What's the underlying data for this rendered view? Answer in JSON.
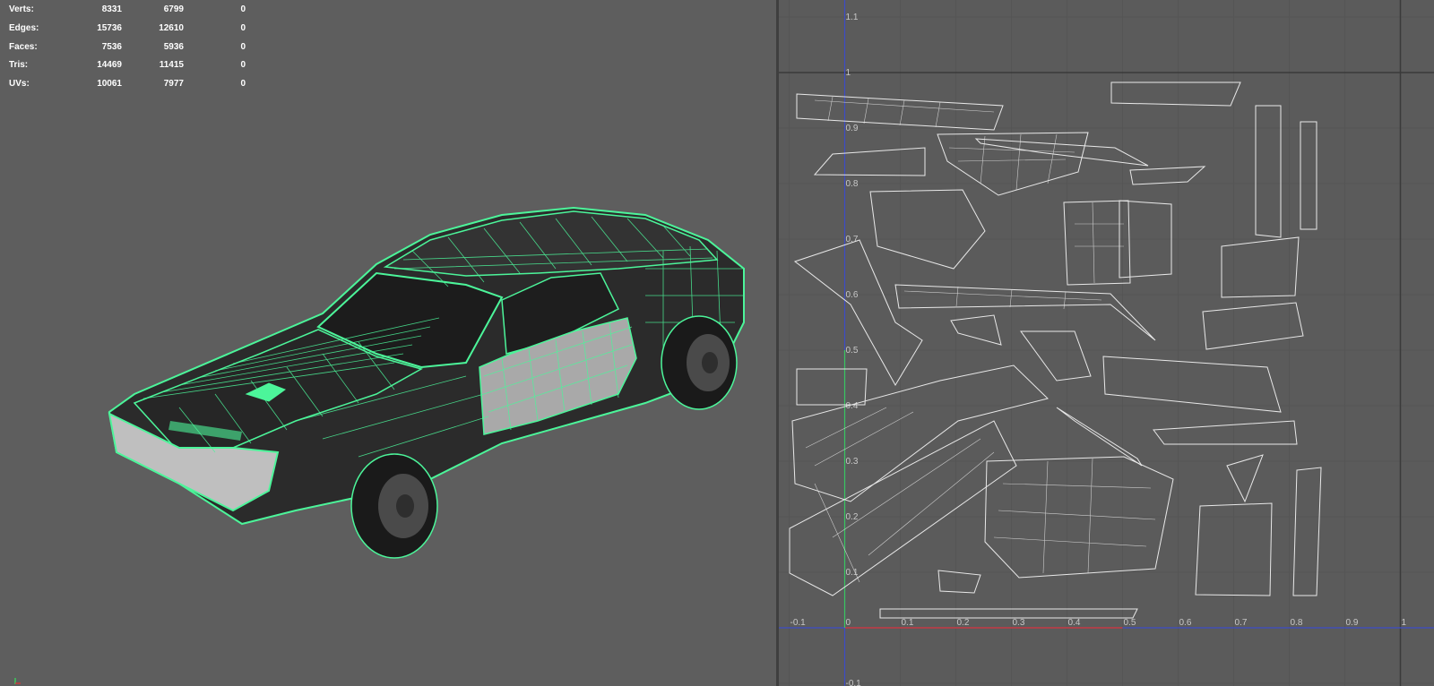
{
  "stats": {
    "rows": [
      {
        "label": "Verts:",
        "v1": "8331",
        "v2": "6799",
        "v3": "0"
      },
      {
        "label": "Edges:",
        "v1": "15736",
        "v2": "12610",
        "v3": "0"
      },
      {
        "label": "Faces:",
        "v1": "7536",
        "v2": "5936",
        "v3": "0"
      },
      {
        "label": "Tris:",
        "v1": "14469",
        "v2": "11415",
        "v3": "0"
      },
      {
        "label": "UVs:",
        "v1": "10061",
        "v2": "7977",
        "v3": "0"
      }
    ]
  },
  "uv_editor": {
    "u_ticks": [
      "-0.1",
      "0",
      "0.1",
      "0.2",
      "0.3",
      "0.4",
      "0.5",
      "0.6",
      "0.7",
      "0.8",
      "0.9",
      "1"
    ],
    "v_ticks": [
      "1.1",
      "1",
      "0.9",
      "0.8",
      "0.7",
      "0.6",
      "0.5",
      "0.4",
      "0.3",
      "0.2",
      "0.1",
      "-0.1"
    ]
  },
  "colors": {
    "viewport_bg": "#5e5e5e",
    "uv_bg": "#5b5b5b",
    "wireframe": "#4cf59a",
    "uv_shell_lines": "#e8e8e8",
    "u_axis": "#c83c3c",
    "v_axis": "#3c4cc8",
    "v_axis_lower": "#3cc85a"
  },
  "viewport": {
    "object": "car-model",
    "display": "wireframe-on-shaded"
  }
}
